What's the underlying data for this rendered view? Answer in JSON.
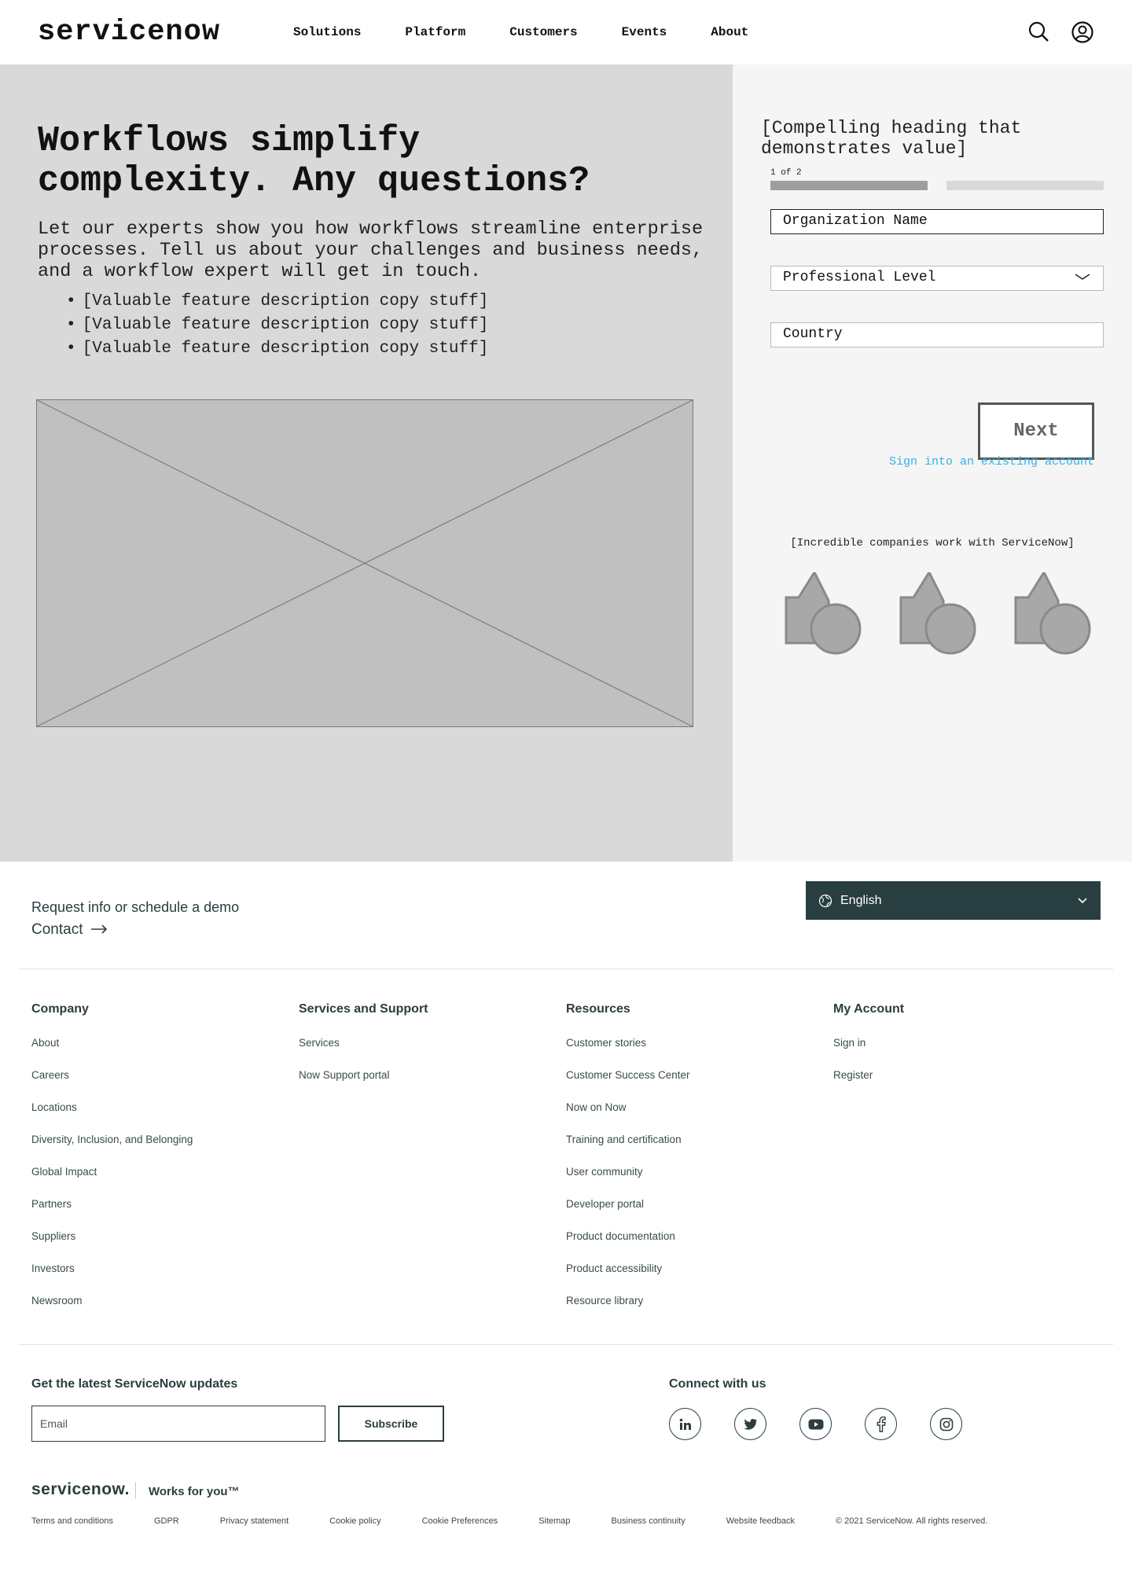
{
  "header": {
    "logo": "servicenow",
    "nav": [
      "Solutions",
      "Platform",
      "Customers",
      "Events",
      "About"
    ],
    "icons": [
      "search-icon",
      "user-account-icon"
    ]
  },
  "hero": {
    "title": "Workflows simplify complexity. Any questions?",
    "subtitle": "Let our experts show you how workflows streamline enterprise processes. Tell us about your challenges and business needs, and a workflow expert will get in touch.",
    "features": [
      "[Valuable feature description copy stuff]",
      "[Valuable feature description copy stuff]",
      "[Valuable feature description copy stuff]"
    ],
    "image_placeholder": "image-placeholder"
  },
  "form": {
    "heading": "[Compelling heading that demonstrates value]",
    "step": "1 of 2",
    "progress_fraction": 0.5,
    "fields": {
      "org_name": "Organization Name",
      "professional_level": "Professional Level",
      "country": "Country"
    },
    "next_label": "Next",
    "signin_label": "Sign into an existing account",
    "link_color": "#2db4e3",
    "companies_title": "[Incredible companies work with ServiceNow]",
    "company_logo_count": 3
  },
  "footer": {
    "request_text": "Request info or schedule a demo",
    "contact_label": "Contact",
    "language": "English",
    "columns": [
      {
        "title": "Company",
        "links": [
          "About",
          "Careers",
          "Locations",
          "Diversity, Inclusion, and Belonging",
          "Global Impact",
          "Partners",
          "Suppliers",
          "Investors",
          "Newsroom"
        ]
      },
      {
        "title": "Services and Support",
        "links": [
          "Services",
          "Now Support portal"
        ]
      },
      {
        "title": "Resources",
        "links": [
          "Customer stories",
          "Customer Success Center",
          "Now on Now",
          "Training and certification",
          "User community",
          "Developer portal",
          "Product documentation",
          "Product accessibility",
          "Resource library"
        ]
      },
      {
        "title": "My Account",
        "links": [
          "Sign in",
          "Register"
        ]
      }
    ],
    "updates_title": "Get the latest ServiceNow updates",
    "email_placeholder": "Email",
    "subscribe_label": "Subscribe",
    "connect_title": "Connect with us",
    "socials": [
      "linkedin-icon",
      "twitter-icon",
      "youtube-icon",
      "facebook-icon",
      "instagram-icon"
    ],
    "brand_logo": "servicenow.",
    "tagline": "Works for you™",
    "legal": [
      "Terms and conditions",
      "GDPR",
      "Privacy statement",
      "Cookie policy",
      "Cookie Preferences",
      "Sitemap",
      "Business continuity",
      "Website feedback"
    ],
    "copyright": "© 2021 ServiceNow. All rights reserved.",
    "dark_color": "#293e40"
  }
}
